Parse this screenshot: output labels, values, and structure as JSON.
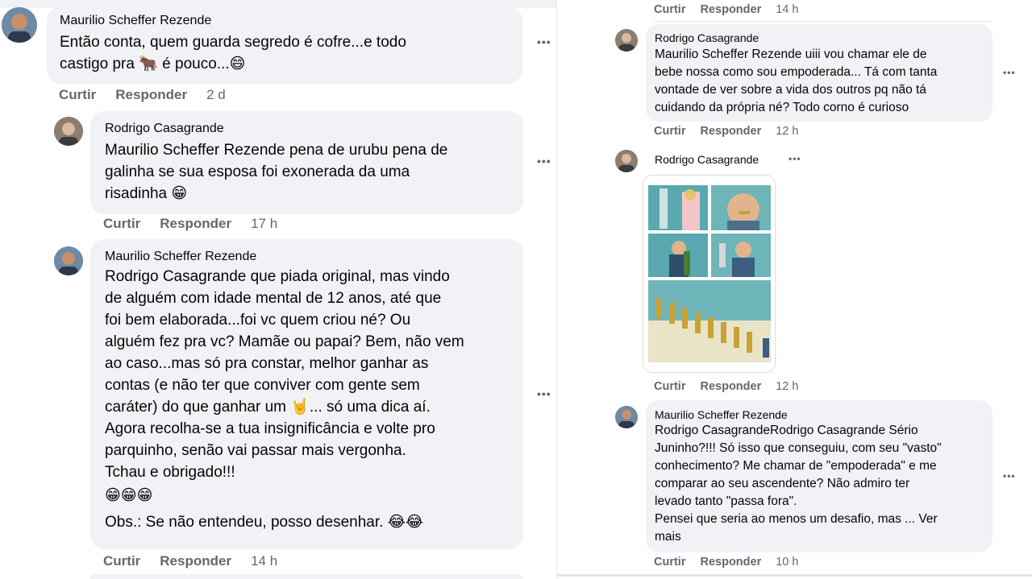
{
  "left": {
    "comments": [
      {
        "author": "Maurilio Scheffer Rezende",
        "lines": [
          "Então conta, quem guarda segredo é cofre...e todo",
          "castigo pra 🐂 é pouco...😄"
        ],
        "actions": {
          "like": "Curtir",
          "reply": "Responder",
          "time": "2 d"
        }
      },
      {
        "author": "Rodrigo Casagrande",
        "lines": [
          "Maurilio Scheffer Rezende pena de urubu pena de",
          "galinha se sua esposa foi exonerada da uma",
          "risadinha 😁"
        ],
        "actions": {
          "like": "Curtir",
          "reply": "Responder",
          "time": "17 h"
        }
      },
      {
        "author": "Maurilio Scheffer Rezende",
        "lines": [
          "Rodrigo Casagrande que piada original, mas vindo",
          "de alguém com idade mental de 12 anos, até que",
          "foi bem elaborada...foi vc quem criou né? Ou",
          "alguém fez pra vc? Mamãe ou papai? Bem, não vem",
          "ao caso...mas só pra constar, melhor ganhar as",
          "contas (e não ter que conviver com gente sem",
          "caráter) do que ganhar um 🤘... só uma dica aí.",
          "Agora recolha-se a tua insignificância e volte pro",
          "parquinho, senão vai passar mais vergonha.",
          "Tchau e obrigado!!!",
          "😁😁😁",
          "Obs.: Se não entendeu, posso desenhar. 😂😂"
        ],
        "actions": {
          "like": "Curtir",
          "reply": "Responder",
          "time": "14 h"
        }
      }
    ]
  },
  "right": {
    "top_actions": {
      "like": "Curtir",
      "reply": "Responder",
      "time": "14 h"
    },
    "comments": [
      {
        "author": "Rodrigo Casagrande",
        "lines": [
          "Maurilio Scheffer Rezende uiii vou chamar ele de",
          "bebe nossa como sou empoderada... Tá com tanta",
          "vontade de ver sobre a vida dos outros pq não tá",
          "cuidando da própria né? Todo corno é curioso"
        ],
        "actions": {
          "like": "Curtir",
          "reply": "Responder",
          "time": "12 h"
        }
      },
      {
        "author": "Rodrigo Casagrande",
        "image_icon": "comic-meme-image",
        "actions": {
          "like": "Curtir",
          "reply": "Responder",
          "time": "12 h"
        }
      },
      {
        "author": "Maurilio Scheffer Rezende",
        "lines": [
          "Rodrigo CasagrandeRodrigo Casagrande Sério",
          "Juninho?!!! Só isso que conseguiu, com seu \"vasto\"",
          "conhecimento? Me chamar de \"empoderada\" e me",
          "comparar ao seu ascendente? Não admiro ter",
          "levado tanto \"passa fora\".",
          "Pensei que seria ao menos um desafio, mas ... Ver",
          "mais"
        ],
        "actions": {
          "like": "Curtir",
          "reply": "Responder",
          "time": "10 h"
        }
      }
    ]
  },
  "more_icon": "•••",
  "colors": {
    "bubble": "#f0f2f5",
    "meta": "#65676b",
    "text": "#050505"
  }
}
